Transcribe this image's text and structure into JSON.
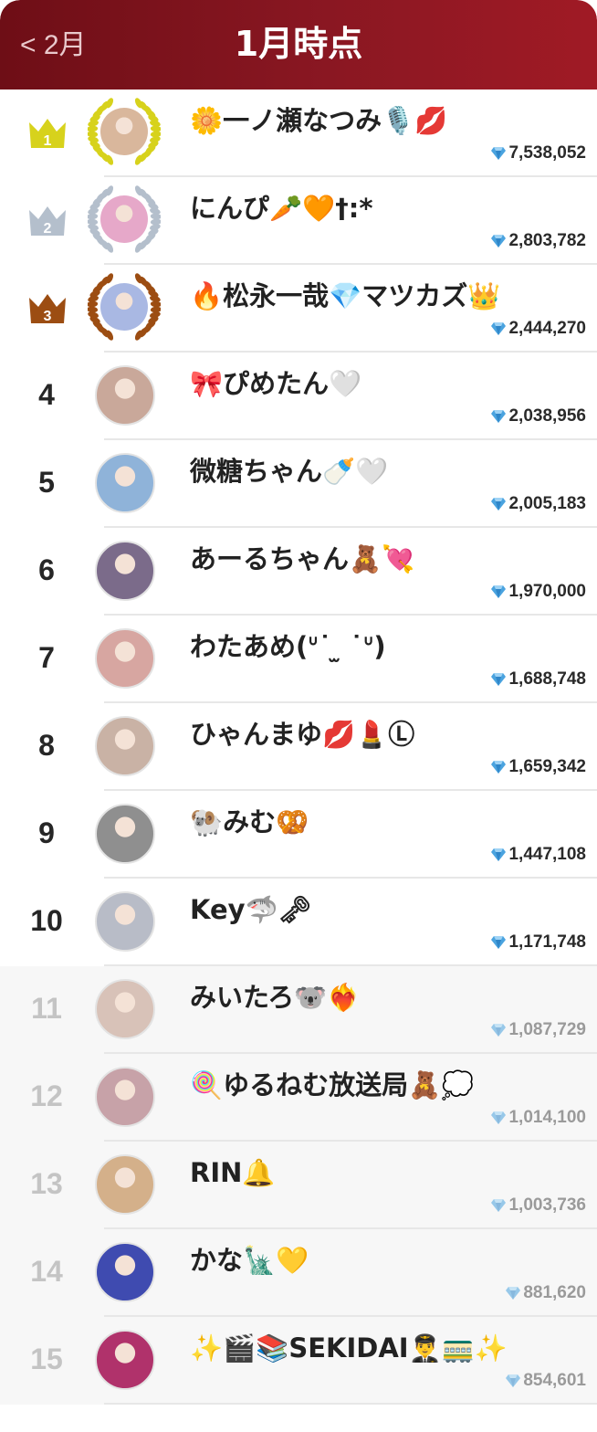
{
  "header": {
    "back_label": "< 2月",
    "title": "1月時点"
  },
  "rankings": [
    {
      "rank": "1",
      "name": "🌼一ノ瀬なつみ🎙️💋",
      "score": "7,538,052",
      "medal": "gold",
      "avatar_color": "#d9b79c"
    },
    {
      "rank": "2",
      "name": "にんぴ🥕🧡†:*",
      "score": "2,803,782",
      "medal": "silver",
      "avatar_color": "#e6a8c9"
    },
    {
      "rank": "3",
      "name": "🔥松永一哉💎マツカズ👑",
      "score": "2,444,270",
      "medal": "bronze",
      "avatar_color": "#a9b8e3"
    },
    {
      "rank": "4",
      "name": "🎀ぴめたん🤍",
      "score": "2,038,956",
      "avatar_color": "#c9a89a"
    },
    {
      "rank": "5",
      "name": "微糖ちゃん🍼🤍",
      "score": "2,005,183",
      "avatar_color": "#8fb3d9"
    },
    {
      "rank": "6",
      "name": "あーるちゃん🧸💘",
      "score": "1,970,000",
      "avatar_color": "#7b6b8a"
    },
    {
      "rank": "7",
      "name": "わたあめ(ᐡ˙ ̫ ˙ᐡ)",
      "score": "1,688,748",
      "avatar_color": "#d7a6a1"
    },
    {
      "rank": "8",
      "name": "ひゃんまゆ💋💄Ⓛ",
      "score": "1,659,342",
      "avatar_color": "#c9b2a5"
    },
    {
      "rank": "9",
      "name": "🐏みむ🥨",
      "score": "1,447,108",
      "avatar_color": "#8f8f8f"
    },
    {
      "rank": "10",
      "name": "Key🦈🗝",
      "score": "1,171,748",
      "avatar_color": "#b8bcc7"
    },
    {
      "rank": "11",
      "name": "みいたろ🐨❤️‍🔥",
      "score": "1,087,729",
      "avatar_color": "#d8c2b8"
    },
    {
      "rank": "12",
      "name": "🍭ゆるねむ放送局🧸💭",
      "score": "1,014,100",
      "avatar_color": "#c7a2a8"
    },
    {
      "rank": "13",
      "name": "RIN🔔",
      "score": "1,003,736",
      "avatar_color": "#d4b08a"
    },
    {
      "rank": "14",
      "name": "かな🗽💛",
      "score": "881,620",
      "avatar_color": "#3f4bb0"
    },
    {
      "rank": "15",
      "name": "✨🎬📚SEKIDAI👨‍✈️🚃✨",
      "score": "854,601",
      "avatar_color": "#b0326b"
    }
  ],
  "colors": {
    "header_start": "#6e0e16",
    "header_end": "#a01a25",
    "gold": "#d7d21c",
    "silver": "#b4bfcc",
    "bronze": "#9c4d12",
    "gem": "#4aa3df"
  },
  "icons": {
    "crown": "crown-icon",
    "gem": "diamond-icon",
    "back": "chevron-left-icon"
  }
}
